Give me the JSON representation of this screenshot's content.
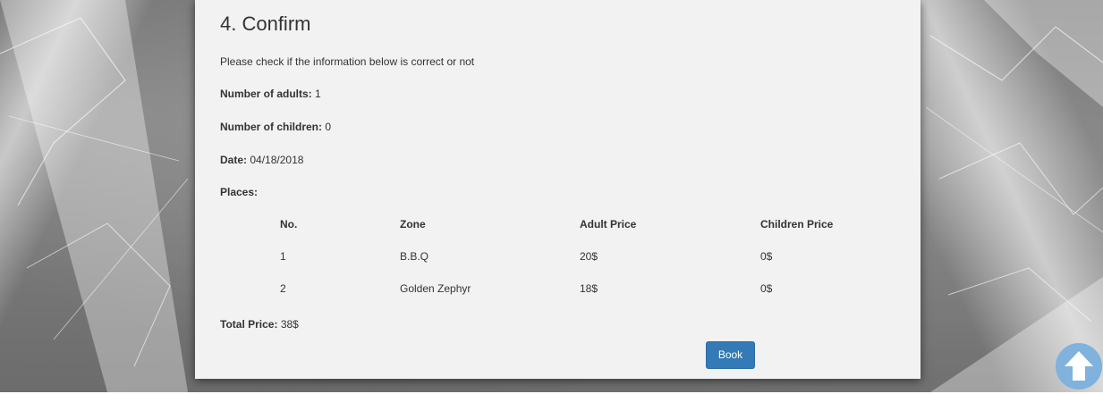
{
  "confirm": {
    "title": "4. Confirm",
    "instruction": "Please check if the information below is correct or not",
    "adults_label": "Number of adults:",
    "adults_value": "1",
    "children_label": "Number of children:",
    "children_value": "0",
    "date_label": "Date:",
    "date_value": "04/18/2018",
    "places_label": "Places:",
    "table": {
      "headers": [
        "No.",
        "Zone",
        "Adult Price",
        "Children Price"
      ],
      "rows": [
        [
          "1",
          "B.B.Q",
          "20$",
          "0$"
        ],
        [
          "2",
          "Golden Zephyr",
          "18$",
          "0$"
        ]
      ]
    },
    "total_label": "Total Price:",
    "total_value": "38$",
    "book_label": "Book"
  },
  "colors": {
    "primary_button": "#337ab7",
    "scroll_top_button": "#7fb2dc",
    "panel": "#f2f2f2"
  },
  "icons": {
    "scroll_top": "arrow-up-icon"
  }
}
